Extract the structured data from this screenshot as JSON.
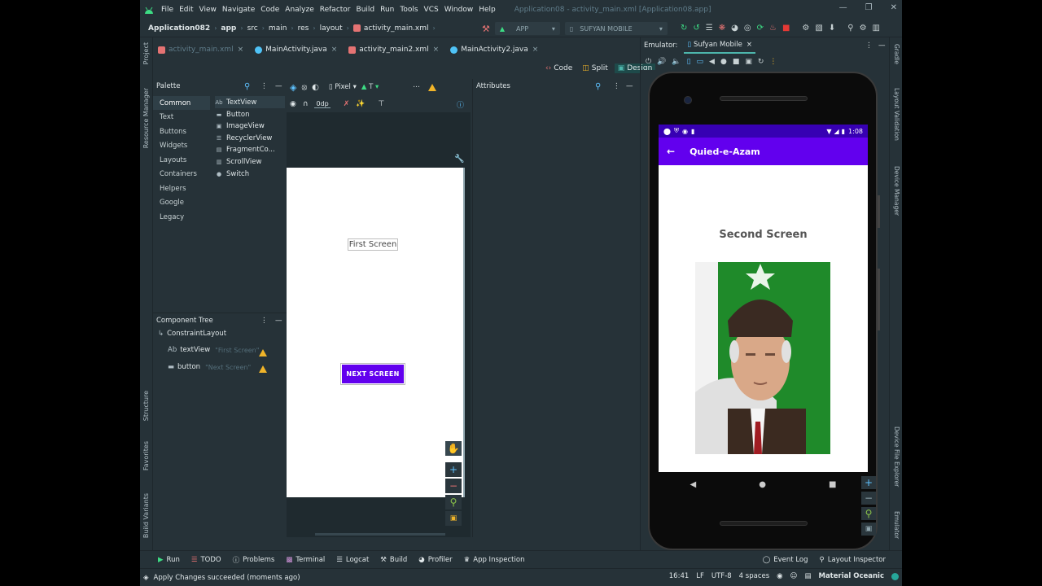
{
  "menu": {
    "items": [
      "File",
      "Edit",
      "View",
      "Navigate",
      "Code",
      "Analyze",
      "Refactor",
      "Build",
      "Run",
      "Tools",
      "VCS",
      "Window",
      "Help"
    ],
    "window_title": "Application08 - activity_main.xml [Application08.app]"
  },
  "nav": {
    "crumbs": [
      "Application082",
      "app",
      "src",
      "main",
      "res",
      "layout",
      "activity_main.xml"
    ],
    "run_config": "APP",
    "device": "SUFYAN MOBILE"
  },
  "tabs": [
    {
      "label": "activity_main.xml",
      "active": true
    },
    {
      "label": "MainActivity.java",
      "active": false
    },
    {
      "label": "activity_main2.xml",
      "active": false
    },
    {
      "label": "MainActivity2.java",
      "active": false
    }
  ],
  "modes": {
    "code": "Code",
    "split": "Split",
    "design": "Design"
  },
  "palette": {
    "title": "Palette",
    "categories": [
      "Common",
      "Text",
      "Buttons",
      "Widgets",
      "Layouts",
      "Containers",
      "Helpers",
      "Google",
      "Legacy"
    ],
    "items": [
      {
        "icon": "Ab",
        "label": "TextView"
      },
      {
        "icon": "▬",
        "label": "Button"
      },
      {
        "icon": "▣",
        "label": "ImageView"
      },
      {
        "icon": "☰",
        "label": "RecyclerView"
      },
      {
        "icon": "▤",
        "label": "FragmentCo..."
      },
      {
        "icon": "▥",
        "label": "ScrollView"
      },
      {
        "icon": "●",
        "label": "Switch"
      }
    ]
  },
  "design_toolbar": {
    "device": "Pixel",
    "api": "T",
    "margin": "0dp"
  },
  "attributes": {
    "title": "Attributes"
  },
  "design": {
    "textview_text": "First Screen",
    "button_text": "NEXT SCREEN"
  },
  "component_tree": {
    "title": "Component Tree",
    "root": "ConstraintLayout",
    "children": [
      {
        "icon": "Ab",
        "label": "textView",
        "hint": "\"First Screen\""
      },
      {
        "icon": "▬",
        "label": "button",
        "hint": "\"Next Screen\""
      }
    ]
  },
  "emulator": {
    "label": "Emulator:",
    "tab": "Sufyan Mobile",
    "time": "1:08",
    "app_title": "Quied-e-Azam",
    "screen_text": "Second Screen"
  },
  "left_strip": [
    "Project",
    "Resource Manager",
    "Structure",
    "Favorites",
    "Build Variants"
  ],
  "right_strip": [
    "Gradle",
    "Layout Validation",
    "Device Manager",
    "Device File Explorer",
    "Emulator"
  ],
  "bottom_tools": [
    "Run",
    "TODO",
    "Problems",
    "Terminal",
    "Logcat",
    "Build",
    "Profiler",
    "App Inspection"
  ],
  "bottom_right_tools": [
    "Event Log",
    "Layout Inspector"
  ],
  "status": {
    "message": "Apply Changes succeeded (moments ago)",
    "position": "16:41",
    "line_sep": "LF",
    "encoding": "UTF-8",
    "indent": "4 spaces",
    "theme": "Material Oceanic"
  },
  "colors": {
    "accent": "#6200ee",
    "status_bar": "#3700b3",
    "ide_bg": "#263238"
  }
}
